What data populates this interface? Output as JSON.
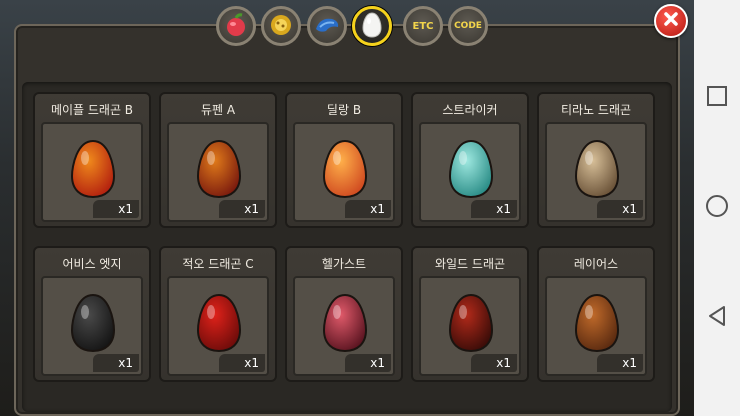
{
  "tabs": [
    {
      "name": "tab-fruit",
      "icon": "red-fruit-icon",
      "active": false
    },
    {
      "name": "tab-gold",
      "icon": "gold-leaf-icon",
      "active": false
    },
    {
      "name": "tab-blue",
      "icon": "blue-bird-icon",
      "active": false
    },
    {
      "name": "tab-egg",
      "icon": "egg-icon",
      "active": true
    },
    {
      "name": "tab-etc",
      "label": "ETC",
      "active": false
    },
    {
      "name": "tab-code",
      "label": "CODE",
      "active": false
    }
  ],
  "close_icon": "close-icon",
  "eggs": [
    {
      "name": "메이플 드래곤 B",
      "qty": "x1",
      "colors": [
        "#f08a1c",
        "#b3200f"
      ]
    },
    {
      "name": "듀펜 A",
      "qty": "x1",
      "colors": [
        "#e07a1a",
        "#7a1a0e"
      ]
    },
    {
      "name": "딜랑 B",
      "qty": "x1",
      "colors": [
        "#ffb04a",
        "#d04a20"
      ]
    },
    {
      "name": "스트라이커",
      "qty": "x1",
      "colors": [
        "#9ee8e0",
        "#2a8c86"
      ]
    },
    {
      "name": "티라노 드래곤",
      "qty": "x1",
      "colors": [
        "#d7bf98",
        "#6a5238"
      ]
    },
    {
      "name": "어비스 엣지",
      "qty": "x1",
      "colors": [
        "#4a4a4a",
        "#151515"
      ]
    },
    {
      "name": "적오 드래곤 C",
      "qty": "x1",
      "colors": [
        "#e0221a",
        "#6e0c0a"
      ]
    },
    {
      "name": "헬가스트",
      "qty": "x1",
      "colors": [
        "#e05a6a",
        "#5a1420"
      ]
    },
    {
      "name": "와일드 드래곤",
      "qty": "x1",
      "colors": [
        "#b22a1a",
        "#3a0c08"
      ]
    },
    {
      "name": "레이어스",
      "qty": "x1",
      "colors": [
        "#c06a2a",
        "#5a2a10"
      ]
    }
  ]
}
